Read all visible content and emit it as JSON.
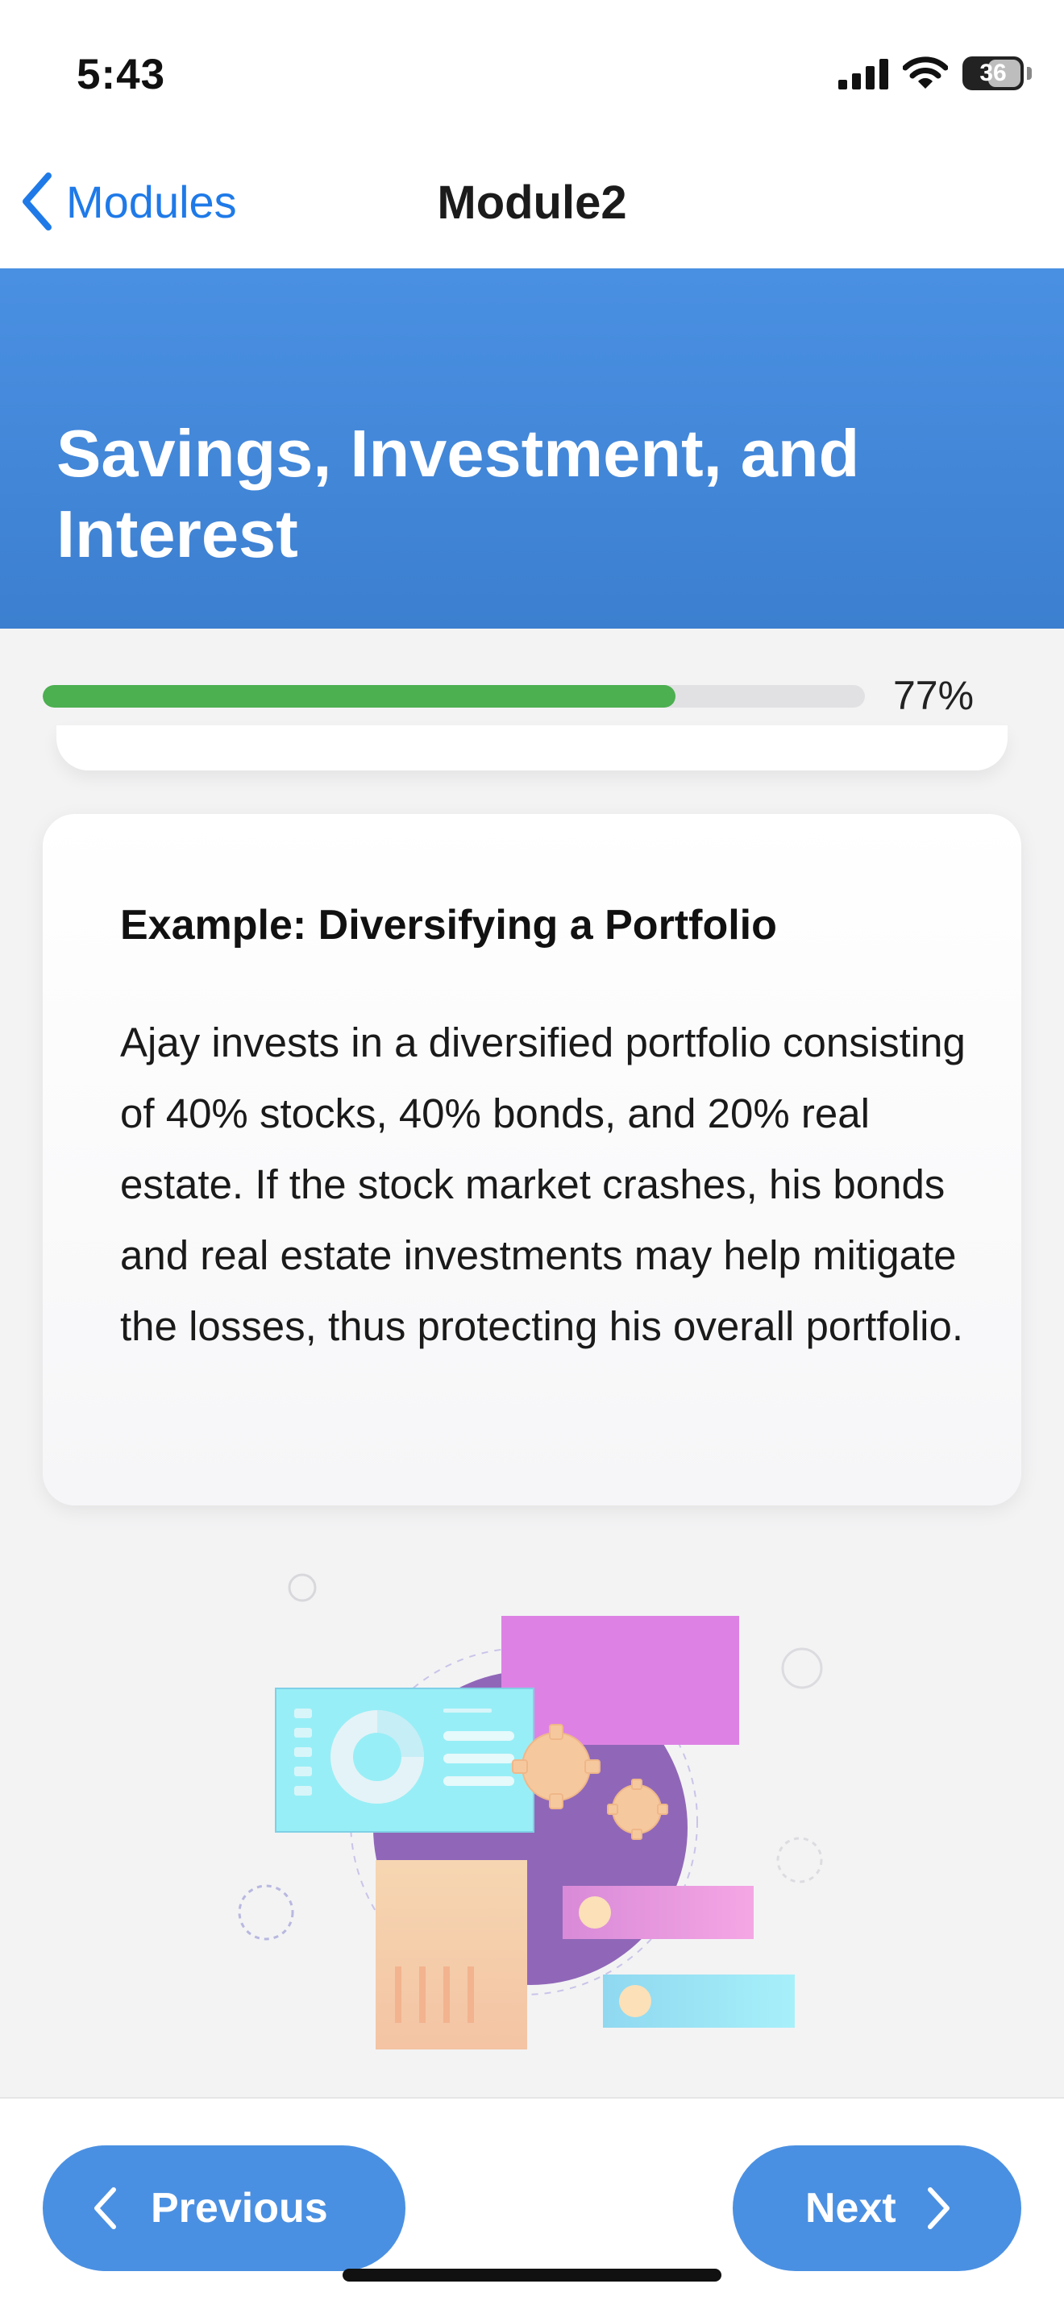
{
  "status_bar": {
    "time": "5:43",
    "battery": "36"
  },
  "nav": {
    "back_label": "Modules",
    "title": "Module2"
  },
  "hero": {
    "title": "Savings, Investment, and Interest"
  },
  "progress": {
    "value": 0.77,
    "label": "77%"
  },
  "card": {
    "title": "Example: Diversifying a Portfolio",
    "body": "Ajay invests in a diversified portfolio consisting of 40% stocks, 40% bonds, and 20% real estate. If the stock market crashes, his bonds and real estate investments may help mitigate the losses, thus protecting his overall portfolio."
  },
  "footer": {
    "previous_label": "Previous",
    "next_label": "Next"
  },
  "colors": {
    "accent": "#4a90e2",
    "progress": "#4caf50",
    "link": "#1f7ae8"
  }
}
